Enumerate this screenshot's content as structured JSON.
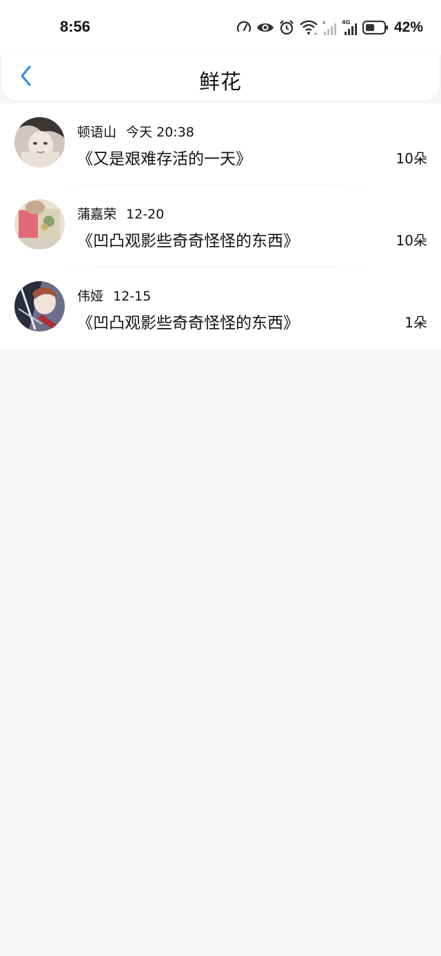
{
  "status_bar": {
    "time": "8:56",
    "battery_percent": "42%",
    "icons": [
      "speed-icon",
      "eye-icon",
      "alarm-icon",
      "wifi-icon",
      "signal-icon",
      "network-4g-icon",
      "battery-icon"
    ]
  },
  "header": {
    "title": "鲜花",
    "back_icon": "chevron-left-icon",
    "accent_color": "#2a8fe0"
  },
  "list": {
    "items": [
      {
        "name": "顿语山",
        "time": "今天 20:38",
        "title": "《又是艰难存活的一天》",
        "count": "10朵"
      },
      {
        "name": "蒲嘉荣",
        "time": "12-20",
        "title": "《凹凸观影些奇奇怪怪的东西》",
        "count": "10朵"
      },
      {
        "name": "伟娅",
        "time": "12-15",
        "title": "《凹凸观影些奇奇怪怪的东西》",
        "count": "1朵"
      }
    ]
  }
}
